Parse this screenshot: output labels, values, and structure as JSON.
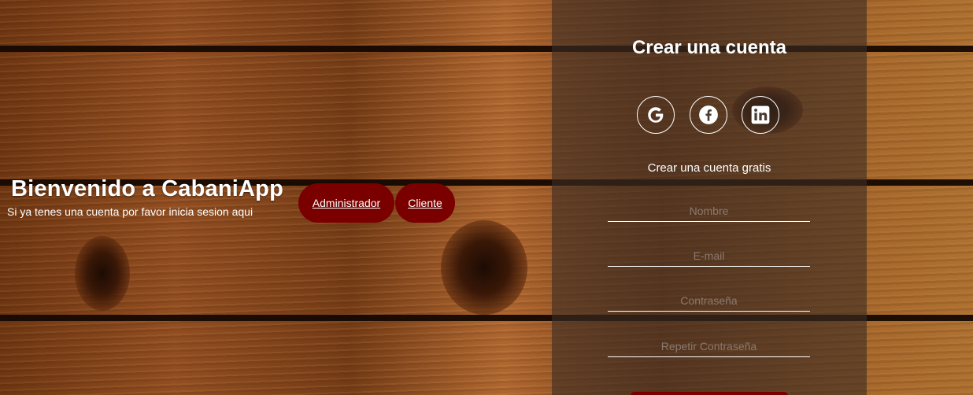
{
  "welcome": {
    "title": "Bienvenido a CabaniApp",
    "subtitle": "Si ya tenes una cuenta por favor inicia sesion aqui",
    "admin_label": "Administrador",
    "client_label": "Cliente"
  },
  "signup": {
    "title": "Crear una cuenta",
    "caption": "Crear una cuenta gratis",
    "social": [
      "google-icon",
      "facebook-icon",
      "linkedin-icon"
    ],
    "fields": {
      "name_placeholder": "Nombre",
      "email_placeholder": "E-mail",
      "password_placeholder": "Contraseña",
      "repeat_password_placeholder": "Repetir Contraseña"
    }
  },
  "colors": {
    "button": "#7a0000",
    "panel_overlay": "rgba(60,45,35,0.62)",
    "text": "#ffffff"
  }
}
